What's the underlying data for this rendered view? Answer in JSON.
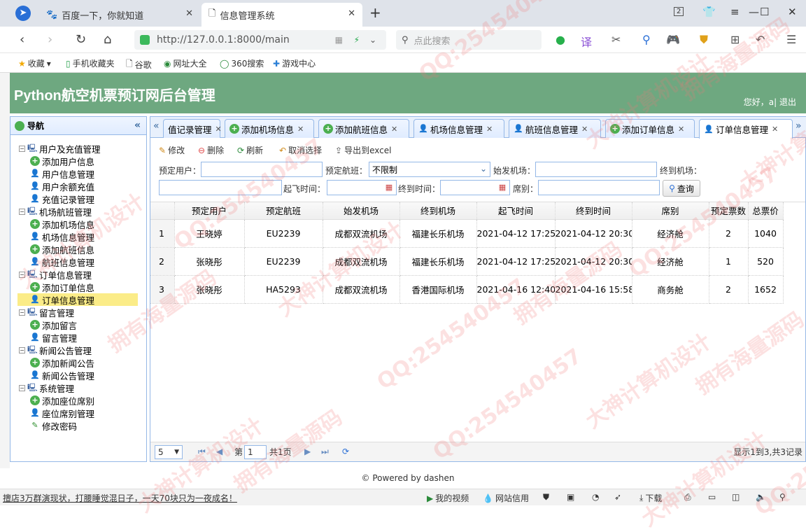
{
  "browser": {
    "tabs": [
      {
        "label": "百度一下，你就知道"
      },
      {
        "label": "信息管理系统"
      }
    ],
    "new_tab": "+",
    "tab_count": "2",
    "url": "http://127.0.0.1:8000/main",
    "search_placeholder": "点此搜索",
    "bookmarks": [
      "收藏",
      "手机收藏夹",
      "谷歌",
      "网址大全",
      "360搜索",
      "游戏中心"
    ]
  },
  "app": {
    "title": "Python航空机票预订网后台管理",
    "greeting": "您好，a| 退出"
  },
  "sidebar": {
    "title": "导航",
    "groups": [
      {
        "label": "用户及充值管理",
        "items": [
          "添加用户信息",
          "用户信息管理",
          "用户余额充值",
          "充值记录管理"
        ]
      },
      {
        "label": "机场航班管理",
        "items": [
          "添加机场信息",
          "机场信息管理",
          "添加航班信息",
          "航班信息管理"
        ]
      },
      {
        "label": "订单信息管理",
        "items": [
          "添加订单信息",
          "订单信息管理"
        ]
      },
      {
        "label": "留言管理",
        "items": [
          "添加留言",
          "留言管理"
        ]
      },
      {
        "label": "新闻公告管理",
        "items": [
          "添加新闻公告",
          "新闻公告管理"
        ]
      },
      {
        "label": "系统管理",
        "items": [
          "添加座位席别",
          "座位席别管理",
          "修改密码"
        ]
      }
    ]
  },
  "main_tabs": [
    "值记录管理",
    "添加机场信息",
    "添加航班信息",
    "机场信息管理",
    "航班信息管理",
    "添加订单信息",
    "订单信息管理"
  ],
  "toolbar": {
    "edit": "修改",
    "delete": "删除",
    "refresh": "刷新",
    "cancel_select": "取消选择",
    "export": "导出到excel"
  },
  "filters": {
    "user_label": "预定用户：",
    "flight_label": "预定航班：",
    "flight_value": "不限制",
    "from_label": "始发机场：",
    "to_label": "终到机场：",
    "depart_label": "起飞时间：",
    "arrive_label": "终到时间：",
    "seat_label": "席别：",
    "query": "查询"
  },
  "table": {
    "columns": [
      "预定用户",
      "预定航班",
      "始发机场",
      "终到机场",
      "起飞时间",
      "终到时间",
      "席别",
      "预定票数",
      "总票价"
    ],
    "rows": [
      {
        "n": "1",
        "cells": [
          "王晓婷",
          "EU2239",
          "成都双流机场",
          "福建长乐机场",
          "2021-04-12 17:25",
          "2021-04-12 20:30",
          "经济舱",
          "2",
          "1040"
        ]
      },
      {
        "n": "2",
        "cells": [
          "张晓彤",
          "EU2239",
          "成都双流机场",
          "福建长乐机场",
          "2021-04-12 17:25",
          "2021-04-12 20:30",
          "经济舱",
          "1",
          "520"
        ]
      },
      {
        "n": "3",
        "cells": [
          "张晓彤",
          "HA5293",
          "成都双流机场",
          "香港国际机场",
          "2021-04-16 12:40",
          "2021-04-16 15:58",
          "商务舱",
          "2",
          "1652"
        ]
      }
    ]
  },
  "pager": {
    "page_size": "5",
    "page_prefix": "第",
    "page_value": "1",
    "page_suffix": "共1页",
    "summary": "显示1到3,共3记录"
  },
  "footer": "© Powered by dashen",
  "statusbar": {
    "news": "擅店3万群演现状，打腰睡觉混日子，一天70块只为一夜成名！",
    "video": "我的视频",
    "credit": "网站信用",
    "download": "下载"
  },
  "watermarks": [
    "QQ:254540457",
    "大神计算机设计",
    "拥有海量源码"
  ]
}
